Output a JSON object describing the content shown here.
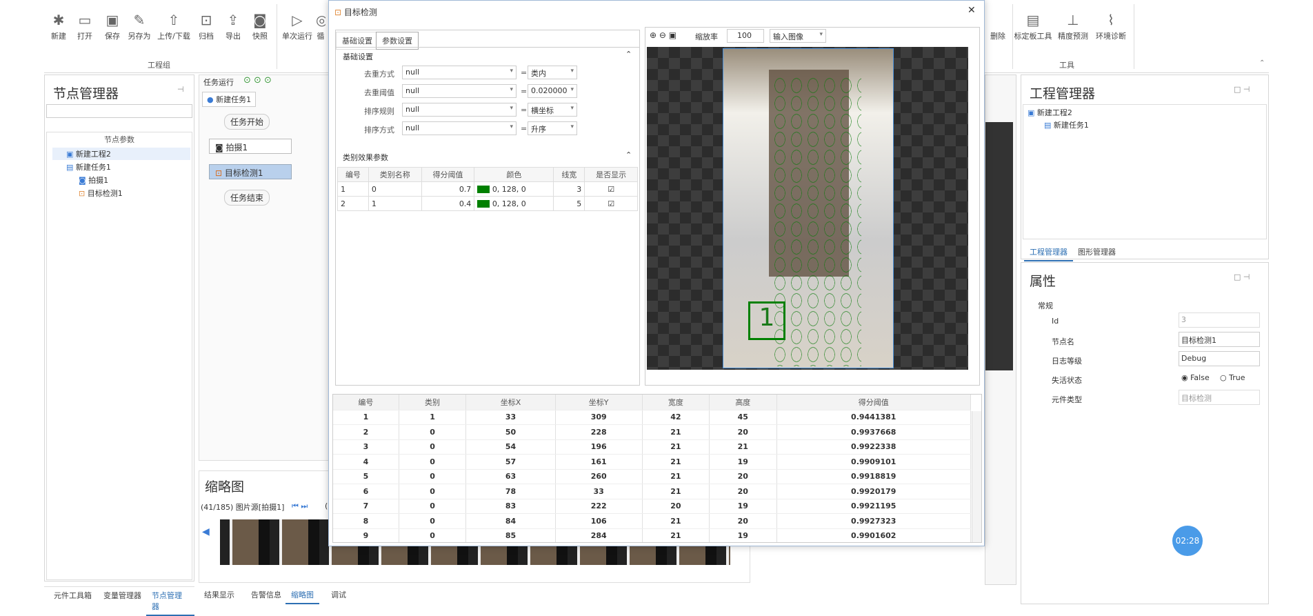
{
  "ribbon": {
    "buttons": [
      "新建",
      "打开",
      "保存",
      "另存为",
      "上传/下载",
      "归档",
      "导出",
      "快照",
      "单次运行",
      "循"
    ],
    "right_buttons": [
      "删除",
      "标定板工具",
      "精度预测",
      "环境诊断"
    ],
    "group_left": "工程组",
    "group_right": "工具"
  },
  "node_manager": {
    "title": "节点管理器",
    "header": "节点参数",
    "items": [
      "新建工程2",
      "新建任务1",
      "拍摄1",
      "目标检测1"
    ]
  },
  "task_bar": {
    "label": "任务运行",
    "tab": "新建任务1",
    "flow": {
      "start": "任务开始",
      "n1": "拍摄1",
      "n2": "目标检测1",
      "end": "任务结束"
    }
  },
  "thumbnail": {
    "title": "缩略图",
    "info": "(41/185) 图片源[拍摄1]",
    "extra": "("
  },
  "bottom_tabs_left": [
    "元件工具箱",
    "变量管理器",
    "节点管理器"
  ],
  "bottom_tabs_mid": [
    "结果显示",
    "告警信息",
    "缩略图",
    "调试"
  ],
  "project_manager": {
    "title": "工程管理器",
    "items": [
      "新建工程2",
      "新建任务1"
    ],
    "tabs": [
      "工程管理器",
      "图形管理器"
    ]
  },
  "properties": {
    "title": "属性",
    "section": "常规",
    "rows": [
      {
        "label": "Id",
        "value": "3"
      },
      {
        "label": "节点名",
        "value": "目标检测1"
      },
      {
        "label": "日志等级",
        "value": "Debug"
      },
      {
        "label": "失活状态",
        "value": ""
      },
      {
        "label": "元件类型",
        "value": "目标检测"
      }
    ],
    "radio_false": "False",
    "radio_true": "True"
  },
  "dialog": {
    "title": "目标检测",
    "close": "✕",
    "tabs": [
      "基础设置",
      "参数设置"
    ],
    "basic_section": "基础设置",
    "params": [
      {
        "label": "去重方式",
        "value": "null",
        "right": "类内"
      },
      {
        "label": "去重阈值",
        "value": "null",
        "right": "0.020000"
      },
      {
        "label": "排序规则",
        "value": "null",
        "right": "横坐标"
      },
      {
        "label": "排序方式",
        "value": "null",
        "right": "升序"
      }
    ],
    "class_section": "类别效果参数",
    "class_headers": [
      "编号",
      "类别名称",
      "得分阈值",
      "颜色",
      "线宽",
      "是否显示"
    ],
    "class_rows": [
      {
        "id": "1",
        "name": "0",
        "thr": "0.7",
        "color": "0, 128, 0",
        "width": "3"
      },
      {
        "id": "2",
        "name": "1",
        "thr": "0.4",
        "color": "0, 128, 0",
        "width": "5"
      }
    ],
    "zoom_label": "缩放率",
    "zoom": "100",
    "image_select": "输入图像",
    "result_headers": [
      "编号",
      "类别",
      "坐标X",
      "坐标Y",
      "宽度",
      "高度",
      "得分阈值"
    ],
    "results": [
      [
        "1",
        "1",
        "33",
        "309",
        "42",
        "45",
        "0.9441381"
      ],
      [
        "2",
        "0",
        "50",
        "228",
        "21",
        "20",
        "0.9937668"
      ],
      [
        "3",
        "0",
        "54",
        "196",
        "21",
        "21",
        "0.9922338"
      ],
      [
        "4",
        "0",
        "57",
        "161",
        "21",
        "19",
        "0.9909101"
      ],
      [
        "5",
        "0",
        "63",
        "260",
        "21",
        "20",
        "0.9918819"
      ],
      [
        "6",
        "0",
        "78",
        "33",
        "21",
        "20",
        "0.9920179"
      ],
      [
        "7",
        "0",
        "83",
        "222",
        "20",
        "19",
        "0.9921195"
      ],
      [
        "8",
        "0",
        "84",
        "106",
        "21",
        "20",
        "0.9927323"
      ],
      [
        "9",
        "0",
        "85",
        "284",
        "21",
        "19",
        "0.9901602"
      ]
    ]
  },
  "timer": "02:28"
}
